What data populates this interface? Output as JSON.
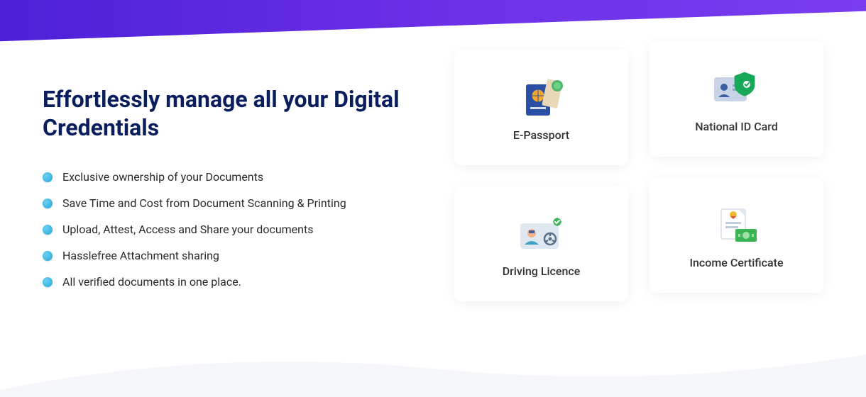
{
  "heading": "Effortlessly manage all your Digital Credentials",
  "bullets": [
    "Exclusive ownership of your Documents",
    "Save Time and Cost from Document Scanning & Printing",
    "Upload, Attest, Access and Share your documents",
    "Hasslefree Attachment sharing",
    "All verified documents in one place."
  ],
  "cards": [
    {
      "label": "E-Passport",
      "icon": "passport-icon"
    },
    {
      "label": "National ID Card",
      "icon": "id-card-icon"
    },
    {
      "label": "Driving Licence",
      "icon": "driving-licence-icon"
    },
    {
      "label": "Income Certificate",
      "icon": "income-certificate-icon"
    }
  ]
}
